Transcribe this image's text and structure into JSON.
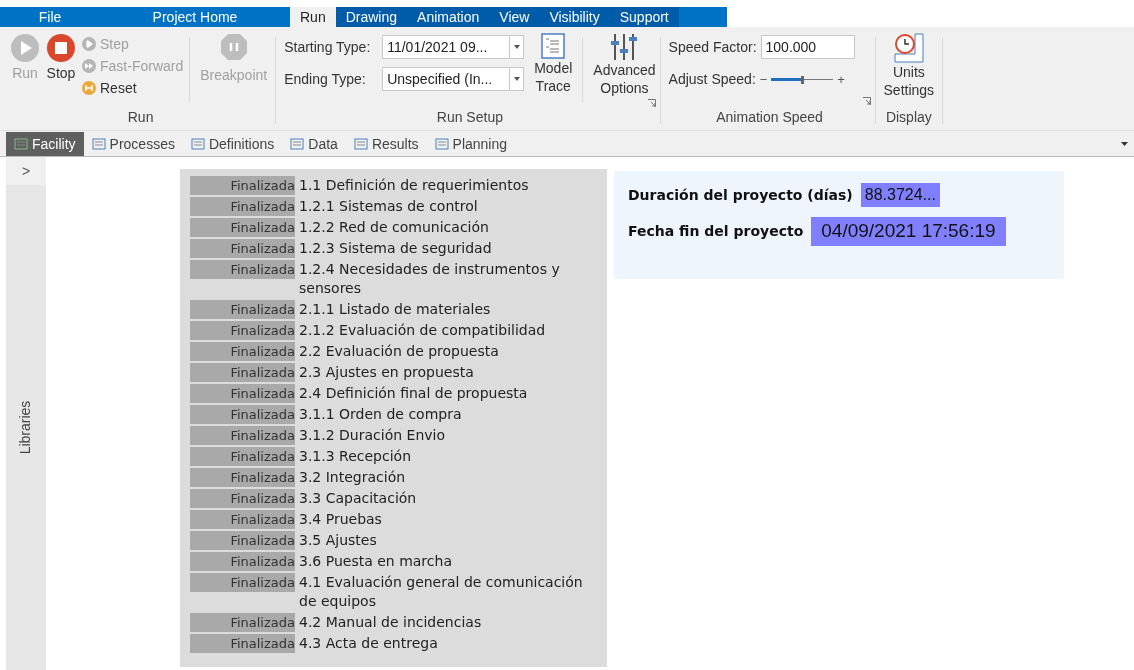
{
  "menu_tabs": [
    {
      "label": "File",
      "selected": false
    },
    {
      "label": "Project Home",
      "selected": false
    },
    {
      "label": "Run",
      "selected": true
    },
    {
      "label": "Drawing",
      "selected": false
    },
    {
      "label": "Animation",
      "selected": false
    },
    {
      "label": "View",
      "selected": false
    },
    {
      "label": "Visibility",
      "selected": false
    },
    {
      "label": "Support",
      "selected": false
    }
  ],
  "ribbon": {
    "run_group": {
      "title": "Run",
      "run": {
        "label": "Run",
        "disabled": true
      },
      "stop": {
        "label": "Stop",
        "disabled": false
      },
      "small_buttons": [
        {
          "label": "Step",
          "disabled": true
        },
        {
          "label": "Fast-Forward",
          "disabled": true
        },
        {
          "label": "Reset",
          "disabled": false
        }
      ],
      "breakpoint": {
        "label": "Breakpoint",
        "disabled": true
      }
    },
    "run_setup": {
      "title": "Run Setup",
      "starting_type": {
        "label": "Starting Type:",
        "value": "11/01/2021 09..."
      },
      "ending_type": {
        "label": "Ending Type:",
        "value": "Unspecified (In..."
      },
      "model_trace": {
        "lines": [
          "Model",
          "Trace"
        ]
      },
      "advanced_options": {
        "lines": [
          "Advanced",
          "Options"
        ]
      }
    },
    "animation_speed": {
      "title": "Animation Speed",
      "speed_factor": {
        "label": "Speed Factor:",
        "value": "100.000"
      },
      "adjust_speed": {
        "label": "Adjust Speed:",
        "minus": "−",
        "plus": "+",
        "level": 0.5
      }
    },
    "display": {
      "title": "Display",
      "units_settings": {
        "lines": [
          "Units",
          "Settings"
        ]
      }
    }
  },
  "view_tabs": [
    {
      "label": "Facility",
      "selected": true
    },
    {
      "label": "Processes",
      "selected": false
    },
    {
      "label": "Definitions",
      "selected": false
    },
    {
      "label": "Data",
      "selected": false
    },
    {
      "label": "Results",
      "selected": false
    },
    {
      "label": "Planning",
      "selected": false
    }
  ],
  "sidebar": {
    "toggle": ">",
    "label": "Libraries"
  },
  "tasks": [
    {
      "status": "Finalizada",
      "name": "1.1 Definición de requerimientos"
    },
    {
      "status": "Finalizada",
      "name": "1.2.1 Sistemas de control"
    },
    {
      "status": "Finalizada",
      "name": "1.2.2 Red de comunicación"
    },
    {
      "status": "Finalizada",
      "name": "1.2.3 Sistema de seguridad"
    },
    {
      "status": "Finalizada",
      "name": "1.2.4 Necesidades de instrumentos y sensores"
    },
    {
      "status": "Finalizada",
      "name": "2.1.1 Listado de materiales"
    },
    {
      "status": "Finalizada",
      "name": "2.1.2 Evaluación de compatibilidad"
    },
    {
      "status": "Finalizada",
      "name": "2.2 Evaluación de propuesta"
    },
    {
      "status": "Finalizada",
      "name": "2.3 Ajustes en propuesta"
    },
    {
      "status": "Finalizada",
      "name": "2.4 Definición final de propuesta"
    },
    {
      "status": "Finalizada",
      "name": "3.1.1 Orden de compra"
    },
    {
      "status": "Finalizada",
      "name": "3.1.2 Duración Envio"
    },
    {
      "status": "Finalizada",
      "name": "3.1.3 Recepción"
    },
    {
      "status": "Finalizada",
      "name": "3.2 Integración"
    },
    {
      "status": "Finalizada",
      "name": "3.3 Capacitación"
    },
    {
      "status": "Finalizada",
      "name": "3.4 Pruebas"
    },
    {
      "status": "Finalizada",
      "name": "3.5 Ajustes"
    },
    {
      "status": "Finalizada",
      "name": "3.6 Puesta en marcha"
    },
    {
      "status": "Finalizada",
      "name": "4.1 Evaluación general de comunicación de equipos"
    },
    {
      "status": "Finalizada",
      "name": "4.2 Manual de incidencias"
    },
    {
      "status": "Finalizada",
      "name": "4.3 Acta de entrega"
    }
  ],
  "summary": [
    {
      "label": "Duración del proyecto (días)",
      "value": "88.3724..."
    },
    {
      "label": "Fecha fin del proyecto",
      "value": "04/09/2021 17:56:19"
    }
  ]
}
